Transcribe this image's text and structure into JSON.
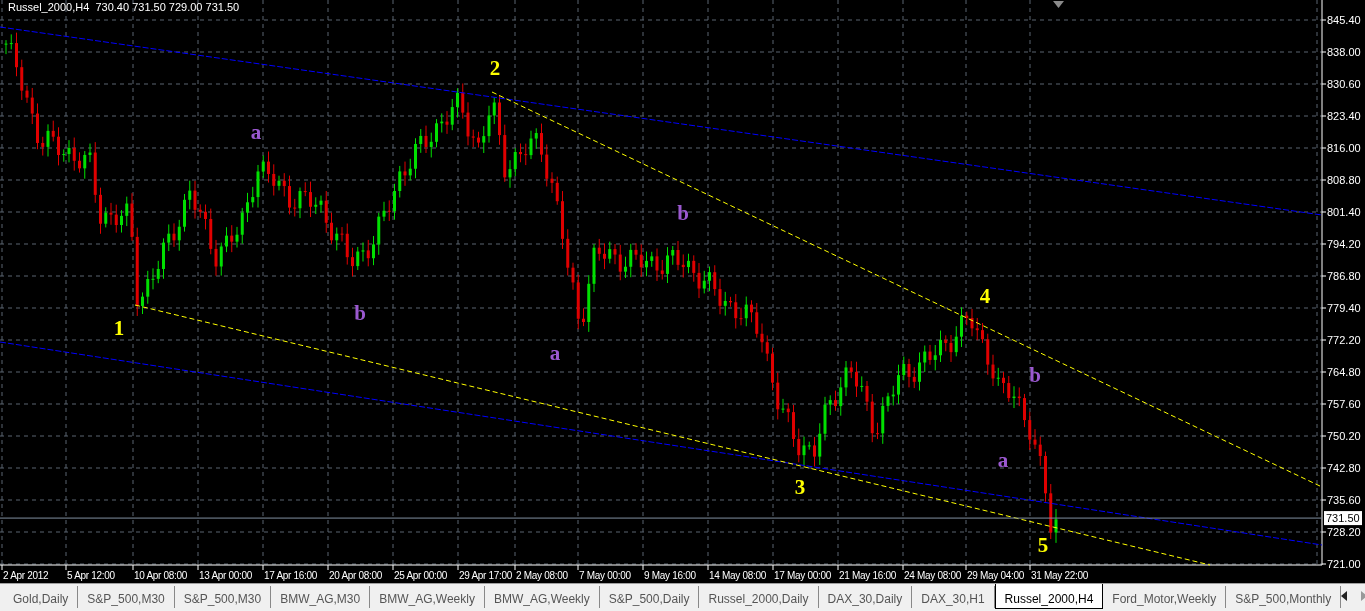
{
  "chart": {
    "title": "Russel_2000,H4  730.40 731.50 729.00 731.50",
    "y_ticks": [
      "845.40",
      "838.00",
      "830.60",
      "823.40",
      "816.00",
      "808.80",
      "801.40",
      "794.20",
      "786.80",
      "779.40",
      "772.20",
      "764.80",
      "757.60",
      "750.20",
      "742.80",
      "735.60",
      "728.20",
      "721.00"
    ],
    "x_ticks": [
      "2 Apr 2012",
      "5 Apr 12:00",
      "10 Apr 08:00",
      "13 Apr 00:00",
      "17 Apr 16:00",
      "20 Apr 08:00",
      "25 Apr 00:00",
      "29 Apr 17:00",
      "2 May 08:00",
      "7 May 00:00",
      "9 May 16:00",
      "14 May 08:00",
      "17 May 00:00",
      "21 May 16:00",
      "24 May 08:00",
      "29 May 04:00",
      "31 May 22:00"
    ],
    "current_price": "731.50",
    "wave_labels": [
      {
        "text": "1",
        "color": "#ffff00"
      },
      {
        "text": "2",
        "color": "#ffff00"
      },
      {
        "text": "3",
        "color": "#ffff00"
      },
      {
        "text": "4",
        "color": "#ffff00"
      },
      {
        "text": "5",
        "color": "#ffff00"
      },
      {
        "text": "a",
        "color": "#9b59d0"
      },
      {
        "text": "b",
        "color": "#9b59d0"
      },
      {
        "text": "b",
        "color": "#9b59d0"
      },
      {
        "text": "a",
        "color": "#9b59d0"
      },
      {
        "text": "b",
        "color": "#9b59d0"
      },
      {
        "text": "a",
        "color": "#9b59d0"
      }
    ]
  },
  "tabs": [
    {
      "label": "Gold,Daily",
      "selected": false
    },
    {
      "label": "S&P_500,M30",
      "selected": false
    },
    {
      "label": "S&P_500,M30",
      "selected": false
    },
    {
      "label": "BMW_AG,M30",
      "selected": false
    },
    {
      "label": "BMW_AG,Weekly",
      "selected": false
    },
    {
      "label": "BMW_AG,Weekly",
      "selected": false
    },
    {
      "label": "S&P_500,Daily",
      "selected": false
    },
    {
      "label": "Russel_2000,Daily",
      "selected": false
    },
    {
      "label": "DAX_30,Daily",
      "selected": false
    },
    {
      "label": "DAX_30,H1",
      "selected": false
    },
    {
      "label": "Russel_2000,H4",
      "selected": true
    },
    {
      "label": "Ford_Motor,Weekly",
      "selected": false
    },
    {
      "label": "S&P_500,Monthly",
      "selected": false
    }
  ]
}
